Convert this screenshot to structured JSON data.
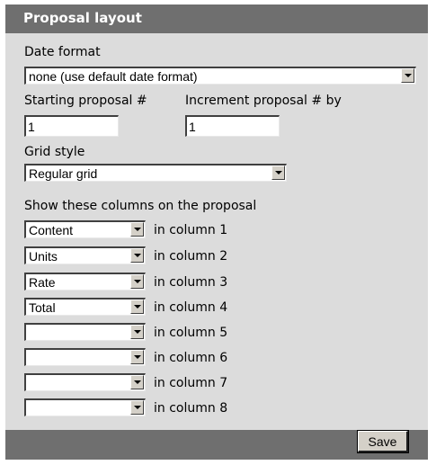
{
  "header": {
    "title": "Proposal layout"
  },
  "date_format": {
    "label": "Date format",
    "selected": "none (use default date format)"
  },
  "starting_proposal": {
    "label": "Starting proposal #",
    "value": "1"
  },
  "increment_proposal": {
    "label": "Increment proposal # by",
    "value": "1"
  },
  "grid_style": {
    "label": "Grid style",
    "selected": "Regular grid"
  },
  "columns": {
    "label": "Show these columns on the proposal",
    "rows": [
      {
        "selected": "Content",
        "suffix": "in column 1"
      },
      {
        "selected": "Units",
        "suffix": "in column 2"
      },
      {
        "selected": "Rate",
        "suffix": "in column 3"
      },
      {
        "selected": "Total",
        "suffix": "in column 4"
      },
      {
        "selected": "",
        "suffix": "in column 5"
      },
      {
        "selected": "",
        "suffix": "in column 6"
      },
      {
        "selected": "",
        "suffix": "in column 7"
      },
      {
        "selected": "",
        "suffix": "in column 8"
      }
    ]
  },
  "footer": {
    "save_label": "Save"
  }
}
